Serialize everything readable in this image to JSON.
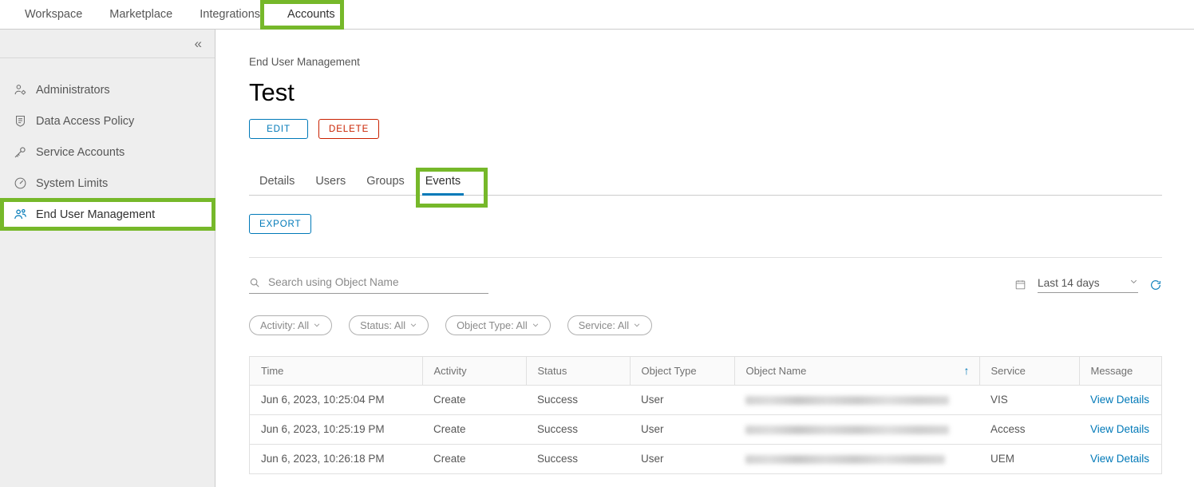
{
  "topnav": {
    "items": [
      {
        "label": "Workspace",
        "active": false
      },
      {
        "label": "Marketplace",
        "active": false
      },
      {
        "label": "Integrations",
        "active": false
      },
      {
        "label": "Accounts",
        "active": true
      }
    ]
  },
  "sidebar": {
    "collapse_icon": "«",
    "items": [
      {
        "label": "Administrators",
        "icon": "user-gear-icon",
        "selected": false
      },
      {
        "label": "Data Access Policy",
        "icon": "shield-document-icon",
        "selected": false
      },
      {
        "label": "Service Accounts",
        "icon": "key-icon",
        "selected": false
      },
      {
        "label": "System Limits",
        "icon": "gauge-icon",
        "selected": false
      },
      {
        "label": "End User Management",
        "icon": "users-group-icon",
        "selected": true
      }
    ]
  },
  "page": {
    "breadcrumb": "End User Management",
    "title": "Test",
    "edit_label": "EDIT",
    "delete_label": "DELETE",
    "export_label": "EXPORT"
  },
  "tabs": [
    {
      "label": "Details",
      "active": false
    },
    {
      "label": "Users",
      "active": false
    },
    {
      "label": "Groups",
      "active": false
    },
    {
      "label": "Events",
      "active": true
    }
  ],
  "search": {
    "placeholder": "Search using Object Name",
    "value": "",
    "icon": "search-icon"
  },
  "daterange": {
    "calendar_icon": "calendar-icon",
    "value": "Last 14 days",
    "chevron": "⌄",
    "refresh_icon": "refresh-icon"
  },
  "chips": [
    {
      "label": "Activity: All"
    },
    {
      "label": "Status: All"
    },
    {
      "label": "Object Type: All"
    },
    {
      "label": "Service: All"
    }
  ],
  "table": {
    "columns": [
      {
        "label": "Time",
        "sorted": false
      },
      {
        "label": "Activity",
        "sorted": false
      },
      {
        "label": "Status",
        "sorted": false
      },
      {
        "label": "Object Type",
        "sorted": false
      },
      {
        "label": "Object Name",
        "sorted": true,
        "sort_dir": "↑"
      },
      {
        "label": "Service",
        "sorted": false
      },
      {
        "label": "Message",
        "sorted": false
      }
    ],
    "rows": [
      {
        "time": "Jun 6, 2023, 10:25:04 PM",
        "activity": "Create",
        "status": "Success",
        "object_type": "User",
        "object_name": "",
        "service": "VIS",
        "message": "View Details"
      },
      {
        "time": "Jun 6, 2023, 10:25:19 PM",
        "activity": "Create",
        "status": "Success",
        "object_type": "User",
        "object_name": "",
        "service": "Access",
        "message": "View Details"
      },
      {
        "time": "Jun 6, 2023, 10:26:18 PM",
        "activity": "Create",
        "status": "Success",
        "object_type": "User",
        "object_name": "",
        "service": "UEM",
        "message": "View Details"
      }
    ]
  },
  "colors": {
    "accent": "#0079b8",
    "danger": "#c92100",
    "annotation": "#76b82a",
    "sidebar_bg": "#eeeeee"
  }
}
